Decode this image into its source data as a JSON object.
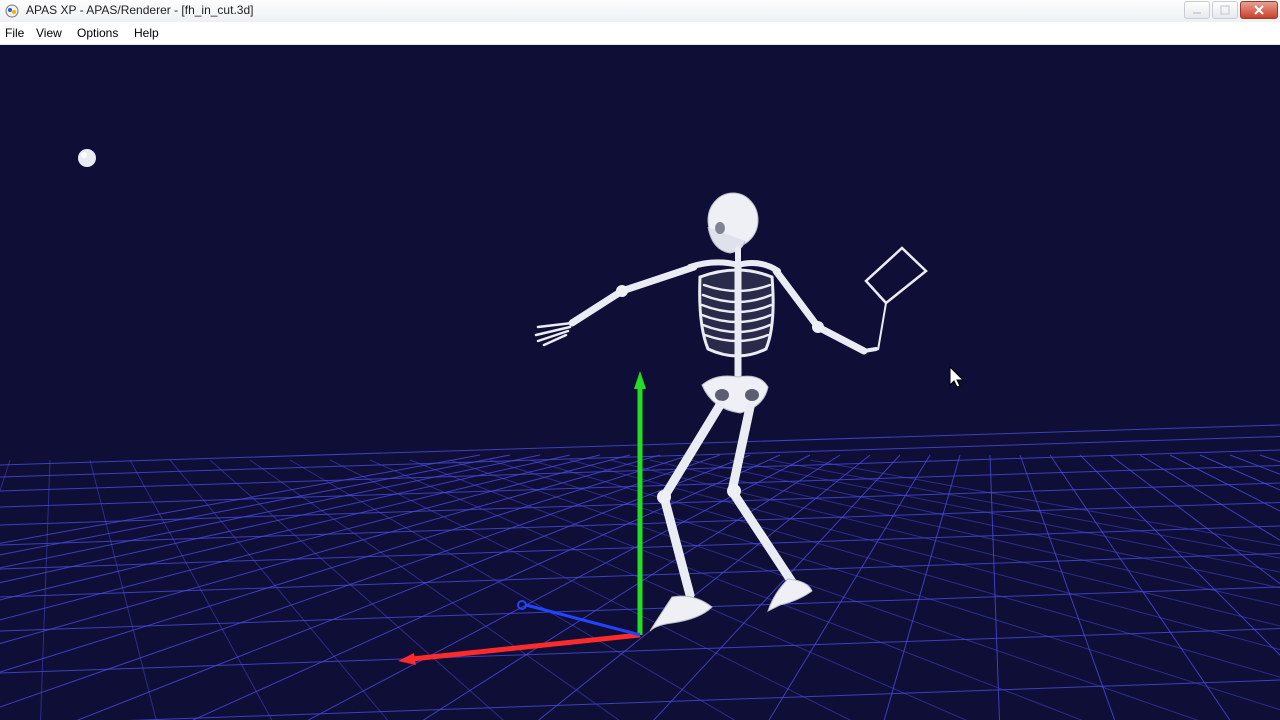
{
  "window": {
    "title": "APAS XP - APAS/Renderer - [fh_in_cut.3d]"
  },
  "menu": {
    "items": [
      "File",
      "View",
      "Options",
      "Help"
    ]
  },
  "scene": {
    "background_color": "#0f0e36",
    "grid_color": "#4a4ae0",
    "axis_x_color": "#ff2a2a",
    "axis_y_color": "#22dd22",
    "axis_z_color": "#2244ff",
    "bone_color": "#e9ecf2"
  }
}
